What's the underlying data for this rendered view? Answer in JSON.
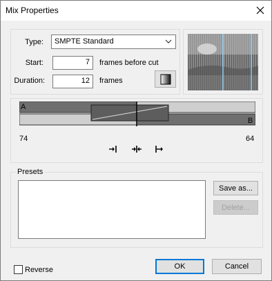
{
  "window": {
    "title": "Mix Properties"
  },
  "transition": {
    "type_label": "Type:",
    "type_value": "SMPTE Standard",
    "start_label": "Start:",
    "start_value": "7",
    "start_units": "frames before cut",
    "duration_label": "Duration:",
    "duration_value": "12",
    "duration_units": "frames"
  },
  "timeline": {
    "track_a_label": "A",
    "track_b_label": "B",
    "left_value": "74",
    "right_value": "64"
  },
  "presets": {
    "group_label": "Presets",
    "save_as_label": "Save as...",
    "delete_label": "Delete..."
  },
  "footer": {
    "reverse_label": "Reverse",
    "ok_label": "OK",
    "cancel_label": "Cancel"
  },
  "icons": [
    "close-icon",
    "dropdown-arrow-icon",
    "gradient-icon",
    "align-start-icon",
    "align-center-icon",
    "align-end-icon"
  ]
}
